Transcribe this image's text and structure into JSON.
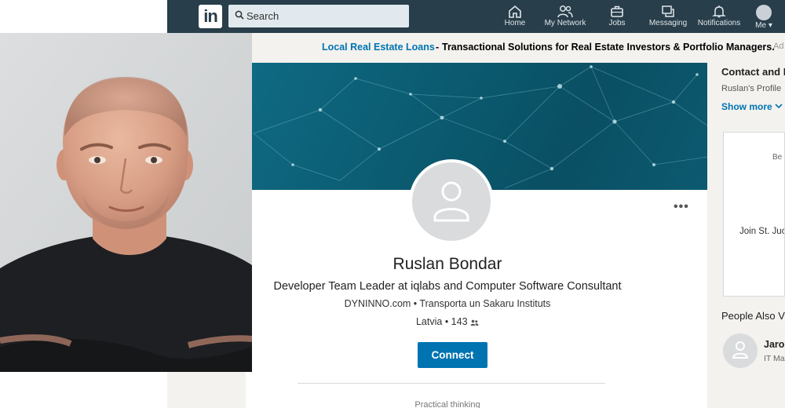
{
  "topnav": {
    "logo": "in",
    "search_placeholder": "Search",
    "items": [
      {
        "label": "Home",
        "icon": "home-icon"
      },
      {
        "label": "My Network",
        "icon": "people-icon"
      },
      {
        "label": "Jobs",
        "icon": "briefcase-icon"
      },
      {
        "label": "Messaging",
        "icon": "chat-icon"
      },
      {
        "label": "Notifications",
        "icon": "bell-icon"
      },
      {
        "label": "Me",
        "icon": "avatar-icon"
      }
    ]
  },
  "ad": {
    "link_text": "Local Real Estate Loans",
    "separator": "-",
    "description": "Transactional Solutions for Real Estate Investors & Portfolio Managers.",
    "tag": "Ad"
  },
  "profile": {
    "name": "Ruslan Bondar",
    "headline": "Developer Team Leader at iqlabs and Computer Software Consultant",
    "company_education": "DYNINNO.com • Transporta un Sakaru Instituts",
    "location": "Latvia",
    "connections": "143",
    "connect_label": "Connect",
    "more_label": "•••",
    "summary_peek": "Practical thinking"
  },
  "rail": {
    "contact_title": "Contact and I",
    "contact_sub": "Ruslan's Profile",
    "show_more": "Show more",
    "ad_top": "Be t",
    "ad_line": "Join St. Juc",
    "people_also_title": "People Also V",
    "person_name": "Jaro",
    "person_role": "IT Ma"
  },
  "colors": {
    "nav_bg": "#283e4a",
    "accent_blue": "#0073b1",
    "page_bg": "#f3f2ef",
    "banner": "#0b5d73"
  }
}
